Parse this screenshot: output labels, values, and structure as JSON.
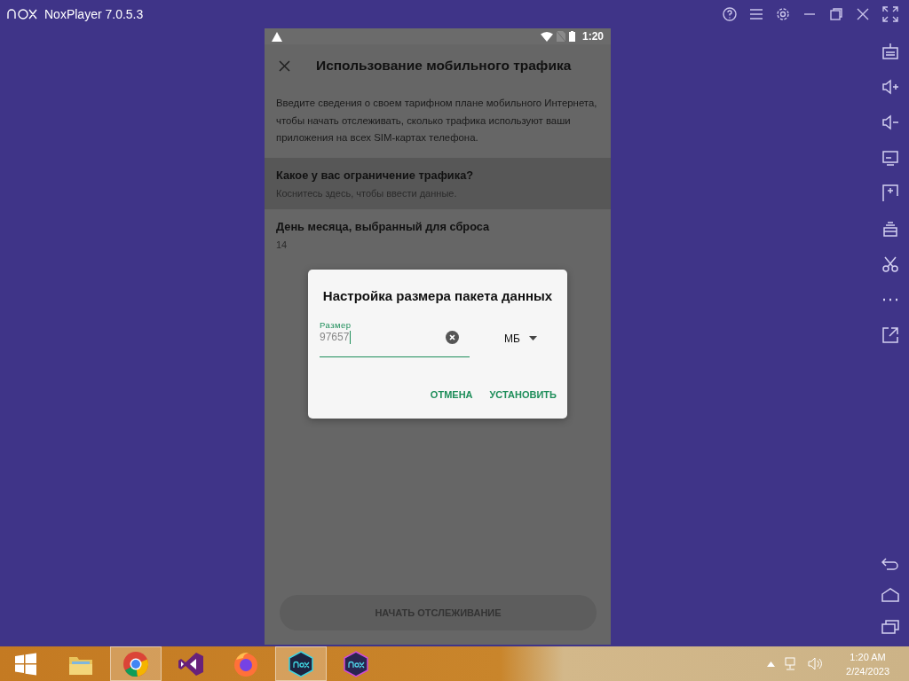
{
  "window": {
    "title": "NoxPlayer 7.0.5.3"
  },
  "status_bar": {
    "time": "1:20"
  },
  "app_bar": {
    "title": "Использование мобильного трафика"
  },
  "intro": "Введите сведения о своем тарифном плане мобильного Интернета, чтобы начать отслеживать, сколько трафика используют ваши приложения на всех SIM-картах телефона.",
  "settings": [
    {
      "title": "Какое у вас ограничение трафика?",
      "summary": "Коснитесь здесь, чтобы ввести данные.",
      "selected": true
    },
    {
      "title": "День месяца, выбранный для сброса",
      "summary": "14",
      "selected": false
    }
  ],
  "primary_button": {
    "label": "НАЧАТЬ ОТСЛЕЖИВАНИЕ",
    "disabled": true
  },
  "dialog": {
    "title": "Настройка размера пакета данных",
    "field": {
      "label": "Размер",
      "value": "97657"
    },
    "unit": "МБ",
    "buttons": [
      "ОТМЕНА",
      "УСТАНОВИТЬ"
    ]
  },
  "taskbar": {
    "apps": [
      {
        "kind": "start",
        "selected": false
      },
      {
        "kind": "folder",
        "selected": false
      },
      {
        "kind": "chrome",
        "selected": true
      },
      {
        "kind": "vs",
        "selected": false
      },
      {
        "kind": "firefox",
        "selected": false
      },
      {
        "kind": "nox",
        "selected": true
      },
      {
        "kind": "noxmulti",
        "selected": false
      }
    ],
    "clock": {
      "time": "1:20 AM",
      "date": "2/24/2023"
    }
  }
}
